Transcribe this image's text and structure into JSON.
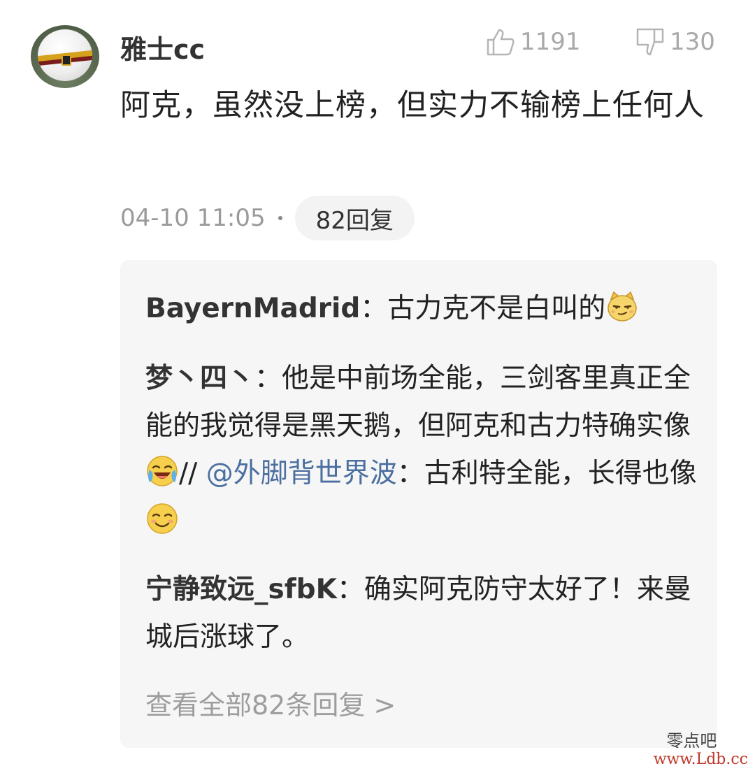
{
  "comment": {
    "username": "雅士cc",
    "like_count": "1191",
    "dislike_count": "130",
    "text": "阿克，虽然没上榜，但实力不输榜上任何人",
    "timestamp": "04-10 11:05",
    "reply_count_label": "82回复"
  },
  "replies": [
    {
      "author": "BayernMadrid",
      "separator": "：",
      "text": "古力克不是白叫的",
      "emoji": "smirk-cat-emoji"
    },
    {
      "author": "梦丶四丶",
      "separator": "：",
      "text_before": "他是中前场全能，三剑客里真正全能的我觉得是黑天鹅，但阿克和古力特确实像",
      "emoji_1": "laugh-cry-emoji",
      "quote_sep": "// ",
      "mention": "@外脚背世界波",
      "mention_sep": "：",
      "text_after": "古利特全能，长得也像",
      "emoji_2": "smile-emoji"
    },
    {
      "author": "宁静致远_sfbK",
      "separator": "：",
      "text": "确实阿克防守太好了！来曼城后涨球了。"
    }
  ],
  "view_all_label": "查看全部82条回复 >",
  "watermark": {
    "cn": "零点吧",
    "url": "www.Ldb.cc"
  },
  "colors": {
    "mention": "#4a6fa0",
    "muted": "#9a9a9a",
    "reply_bg": "#f6f6f6",
    "watermark_url": "#c0392b"
  }
}
